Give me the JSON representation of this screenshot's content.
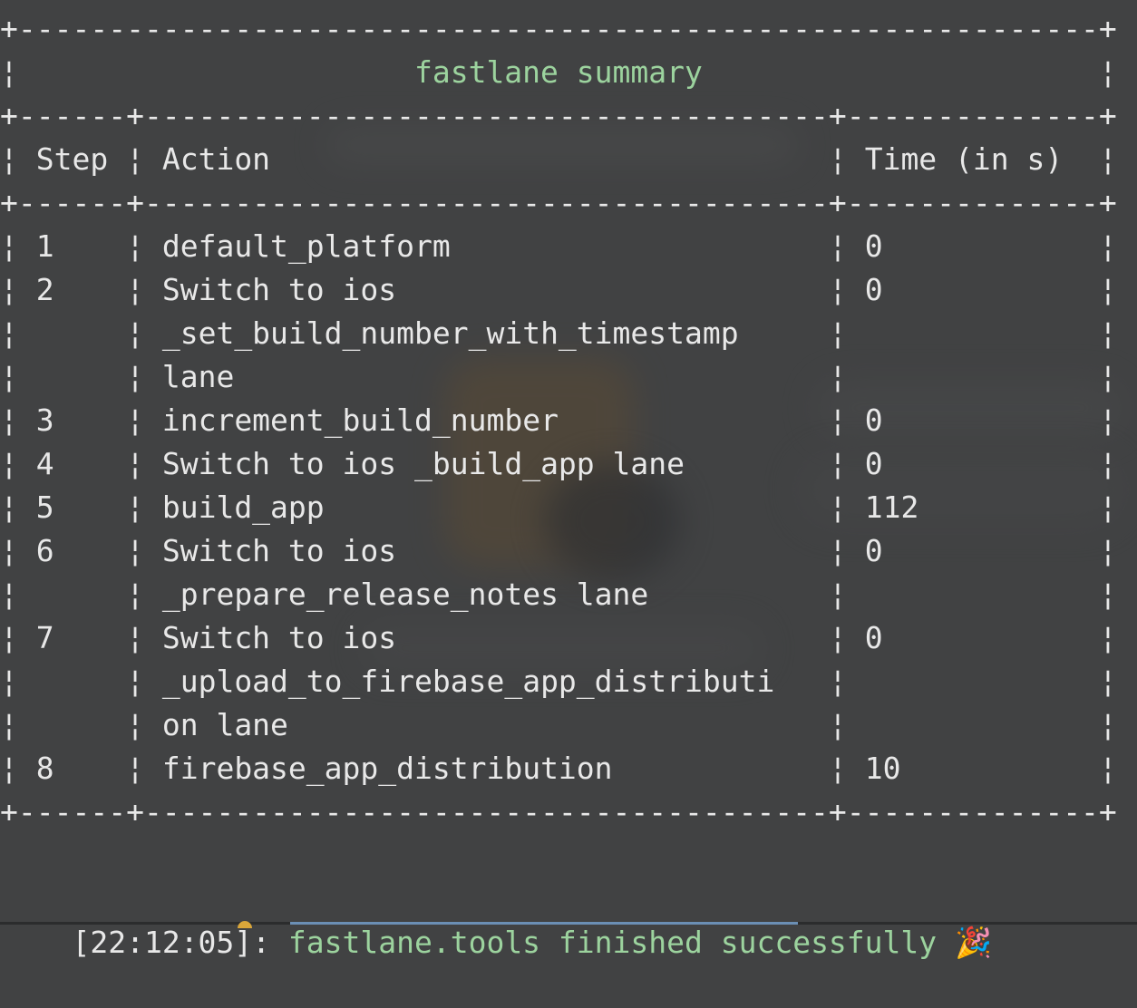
{
  "summary": {
    "title": "fastlane summary",
    "headers": {
      "step": "Step",
      "action": "Action",
      "time": "Time (in s)"
    },
    "rows": [
      {
        "step": "1",
        "action": [
          "default_platform"
        ],
        "time": "0"
      },
      {
        "step": "2",
        "action": [
          "Switch to ios",
          "_set_build_number_with_timestamp",
          "lane"
        ],
        "time": "0"
      },
      {
        "step": "3",
        "action": [
          "increment_build_number"
        ],
        "time": "0"
      },
      {
        "step": "4",
        "action": [
          "Switch to ios _build_app lane"
        ],
        "time": "0"
      },
      {
        "step": "5",
        "action": [
          "build_app"
        ],
        "time": "112"
      },
      {
        "step": "6",
        "action": [
          "Switch to ios",
          "_prepare_release_notes lane"
        ],
        "time": "0"
      },
      {
        "step": "7",
        "action": [
          "Switch to ios",
          "_upload_to_firebase_app_distributi",
          "on lane"
        ],
        "time": "0"
      },
      {
        "step": "8",
        "action": [
          "firebase_app_distribution"
        ],
        "time": "10"
      }
    ]
  },
  "status_line": {
    "timestamp": "[22:12:05]:",
    "message": "fastlane.tools finished successfully",
    "emoji": "🎉"
  },
  "colors": {
    "background": "#414243",
    "text": "#e8e8e8",
    "success_green": "#9cd39e"
  }
}
